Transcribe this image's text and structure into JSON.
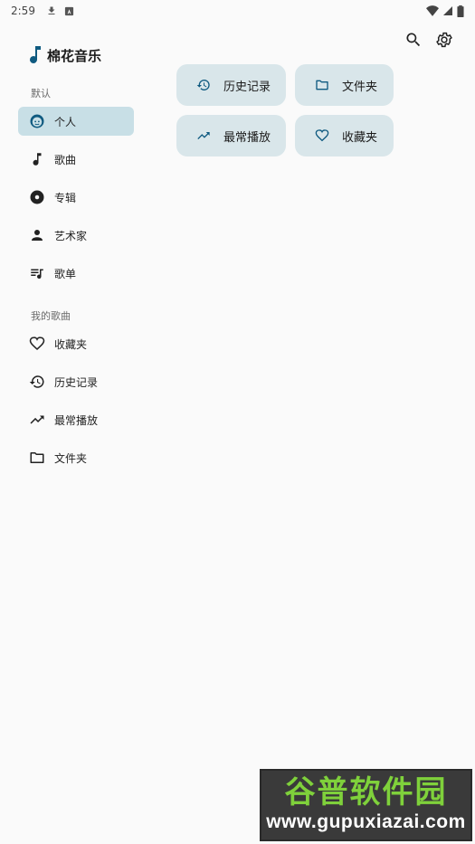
{
  "status_bar": {
    "time": "2:59",
    "icons": [
      "download-icon",
      "notification-a-icon",
      "wifi-icon",
      "signal-icon",
      "battery-icon"
    ]
  },
  "app": {
    "title": "棉花音乐",
    "accent": "#0f5a80",
    "selected_bg": "#c8dfe6",
    "card_bg": "#d9e6ea"
  },
  "toolbar": {
    "icons": [
      "search-icon",
      "settings-icon"
    ]
  },
  "nav": {
    "default_section_label": "默认",
    "default_items": [
      {
        "label": "个人",
        "icon": "face-icon",
        "active": true
      },
      {
        "label": "歌曲",
        "icon": "music-note-icon",
        "active": false
      },
      {
        "label": "专辑",
        "icon": "album-icon",
        "active": false
      },
      {
        "label": "艺术家",
        "icon": "person-icon",
        "active": false
      },
      {
        "label": "歌单",
        "icon": "playlist-icon",
        "active": false
      }
    ],
    "my_songs_section_label": "我的歌曲",
    "my_items": [
      {
        "label": "收藏夹",
        "icon": "heart-icon"
      },
      {
        "label": "历史记录",
        "icon": "history-icon"
      },
      {
        "label": "最常播放",
        "icon": "trending-icon"
      },
      {
        "label": "文件夹",
        "icon": "folder-icon"
      }
    ]
  },
  "quick_cards": [
    {
      "label": "历史记录",
      "icon": "history-icon"
    },
    {
      "label": "文件夹",
      "icon": "folder-icon"
    },
    {
      "label": "最常播放",
      "icon": "trending-icon"
    },
    {
      "label": "收藏夹",
      "icon": "heart-icon"
    }
  ],
  "watermark": {
    "logo_text": "谷普软件园",
    "url": "www.gupuxiazai.com"
  }
}
